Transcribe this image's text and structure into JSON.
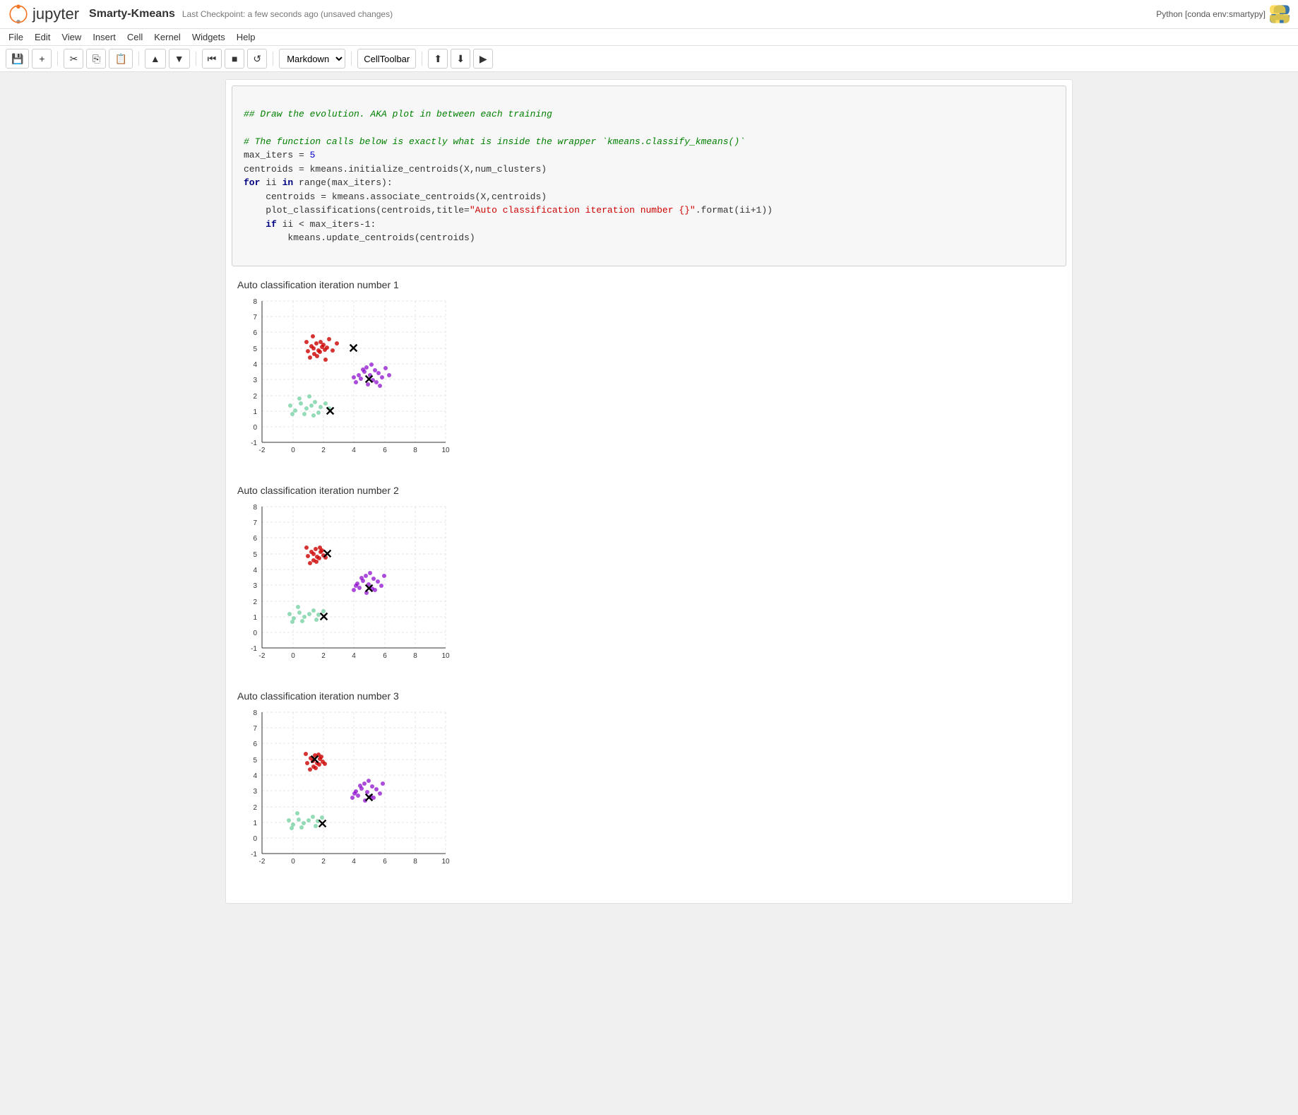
{
  "header": {
    "logo_text": "jupyter",
    "notebook_title": "Smarty-Kmeans",
    "checkpoint_text": "Last Checkpoint: a few seconds ago (unsaved changes)",
    "python_env": "Python [conda env:smartypy]"
  },
  "menubar": {
    "items": [
      "File",
      "Edit",
      "View",
      "Insert",
      "Cell",
      "Kernel",
      "Widgets",
      "Help"
    ]
  },
  "toolbar": {
    "cell_type": "Markdown",
    "celltoolbar": "CellToolbar",
    "buttons": [
      {
        "name": "save",
        "icon": "💾"
      },
      {
        "name": "add-cell",
        "icon": "+"
      },
      {
        "name": "cut",
        "icon": "✂"
      },
      {
        "name": "copy",
        "icon": "⎘"
      },
      {
        "name": "paste",
        "icon": "📋"
      },
      {
        "name": "move-up",
        "icon": "▲"
      },
      {
        "name": "move-down",
        "icon": "▼"
      },
      {
        "name": "skip-to-start",
        "icon": "⏮"
      },
      {
        "name": "stop",
        "icon": "■"
      },
      {
        "name": "restart",
        "icon": "↺"
      },
      {
        "name": "upload",
        "icon": "⬆"
      },
      {
        "name": "download",
        "icon": "⬇"
      },
      {
        "name": "run",
        "icon": "▶"
      }
    ]
  },
  "code_cell": {
    "lines": [
      {
        "text": "## Draw the evolution. AKA plot in between each training",
        "type": "comment"
      },
      {
        "text": "",
        "type": "normal"
      },
      {
        "text": "# The function calls below is exactly what is inside the wrapper `kmeans.classify_kmeans()`",
        "type": "comment"
      },
      {
        "text": "max_iters = 5",
        "type": "code"
      },
      {
        "text": "centroids = kmeans.initialize_centroids(X,num_clusters)",
        "type": "code"
      },
      {
        "text": "for ii in range(max_iters):",
        "type": "code"
      },
      {
        "text": "    centroids = kmeans.associate_centroids(X,centroids)",
        "type": "code"
      },
      {
        "text": "    plot_classifications(centroids,title=\"Auto classification iteration number {}\".format(ii+1))",
        "type": "code_string"
      },
      {
        "text": "    if ii < max_iters-1:",
        "type": "code"
      },
      {
        "text": "        kmeans.update_centroids(centroids)",
        "type": "code"
      }
    ]
  },
  "plots": [
    {
      "title": "Auto classification iteration number 1",
      "id": "plot1"
    },
    {
      "title": "Auto classification iteration number 2",
      "id": "plot2"
    },
    {
      "title": "Auto classification iteration number 3",
      "id": "plot3"
    }
  ]
}
